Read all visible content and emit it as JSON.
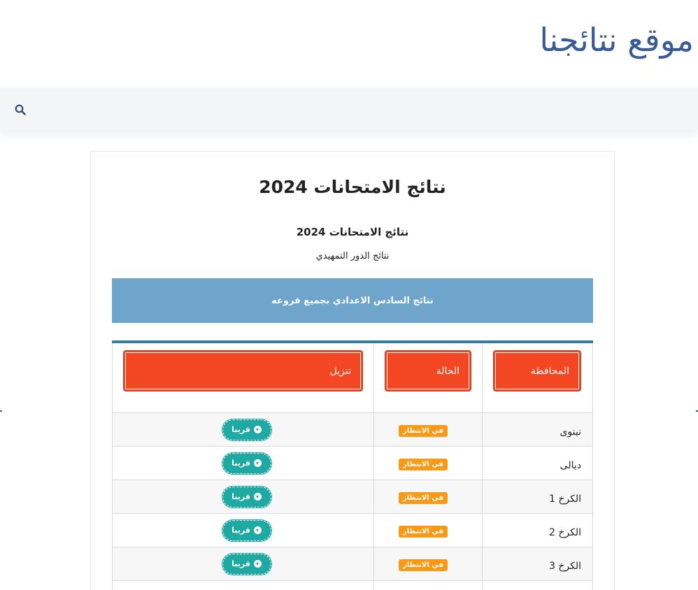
{
  "site": {
    "title": "موقع نتائجنا"
  },
  "nav": {
    "search_icon": "search-icon"
  },
  "article": {
    "title": "نتائج الامتحانات 2024",
    "subtitle": "نتائج الامتحانات 2024",
    "subtitle2": "نتائج الدور التمهيدي",
    "banner": "نتائج السادس الاعدادي بجميع فروعه"
  },
  "table": {
    "headers": {
      "governorate": "المحافظة",
      "status": "الحالة",
      "download": "تنزيل"
    },
    "rows": [
      {
        "governorate": "نينوى",
        "status": "في الانتظار",
        "action": "قريبا"
      },
      {
        "governorate": "ديالى",
        "status": "في الانتظار",
        "action": "قريبا"
      },
      {
        "governorate": "الكرخ 1",
        "status": "في الانتظار",
        "action": "قريبا"
      },
      {
        "governorate": "الكرخ 2",
        "status": "في الانتظار",
        "action": "قريبا"
      },
      {
        "governorate": "الكرخ 3",
        "status": "في الانتظار",
        "action": "قريبا"
      }
    ]
  },
  "colors": {
    "brand": "#3a5a94",
    "banner": "#6fa5ca",
    "header_button": "#f24722",
    "status_badge": "#f99a16",
    "soon_button": "#1eaaa3",
    "table_top_border": "#2f7f9e"
  }
}
